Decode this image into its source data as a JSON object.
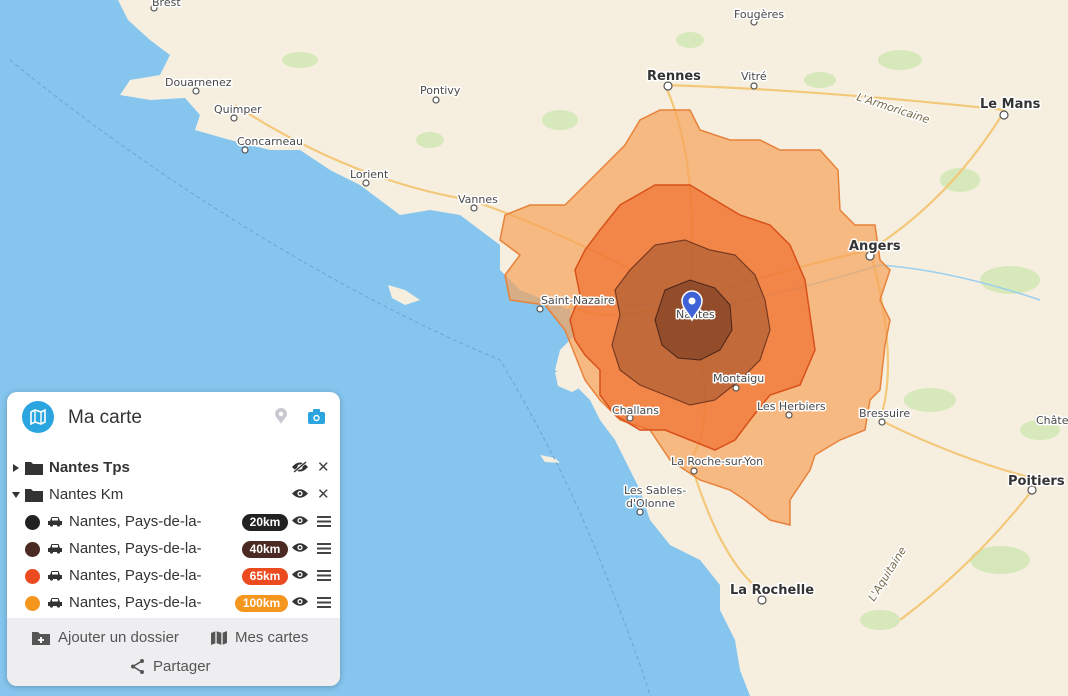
{
  "map": {
    "cities": [
      {
        "name": "Brest"
      },
      {
        "name": "Fougères"
      },
      {
        "name": "Rennes"
      },
      {
        "name": "Vitré"
      },
      {
        "name": "Douarnenez"
      },
      {
        "name": "Pontivy"
      },
      {
        "name": "Le Mans"
      },
      {
        "name": "L'Armoricaine"
      },
      {
        "name": "Quimper"
      },
      {
        "name": "Concarneau"
      },
      {
        "name": "Lorient"
      },
      {
        "name": "Vannes"
      },
      {
        "name": "Angers"
      },
      {
        "name": "Saint-Nazaire"
      },
      {
        "name": "Nantes"
      },
      {
        "name": "Montaigu"
      },
      {
        "name": "Challans"
      },
      {
        "name": "Les Herbiers"
      },
      {
        "name": "Bressuire"
      },
      {
        "name": "Châte"
      },
      {
        "name": "La Roche-sur-Yon"
      },
      {
        "name": "Poitiers"
      },
      {
        "name": "Les Sables-"
      },
      {
        "name": "d'Olonne"
      },
      {
        "name": "La Rochelle"
      },
      {
        "name": "L'Aquitaine"
      }
    ],
    "colors": {
      "sea": "#85c5ee",
      "land": "#f6efe0",
      "zone100": "#f6a35a",
      "zone65": "#ee6a2a",
      "zone40": "#8a4a2a",
      "zone20": "#2a2a2a",
      "marker": "#3f62d6"
    }
  },
  "panel": {
    "title": "Ma carte",
    "icons": {
      "logo": "map-app-icon",
      "pin": "map-pin-icon",
      "camera": "camera-icon"
    },
    "folders": [
      {
        "label": "Nantes Tps",
        "expanded": false,
        "visible": false
      },
      {
        "label": "Nantes Km",
        "expanded": true,
        "visible": true
      }
    ],
    "layers": [
      {
        "label": "Nantes, Pays-de-la-",
        "badge": "20km",
        "color": "#222222",
        "badge_color": "#222222"
      },
      {
        "label": "Nantes, Pays-de-la-",
        "badge": "40km",
        "color": "#4a2a22",
        "badge_color": "#4a2a22"
      },
      {
        "label": "Nantes, Pays-de-la-",
        "badge": "65km",
        "color": "#ec4a1f",
        "badge_color": "#ec4a1f"
      },
      {
        "label": "Nantes, Pays-de-la-",
        "badge": "100km",
        "color": "#f5961f",
        "badge_color": "#f5961f"
      }
    ],
    "footer": {
      "add_folder": "Ajouter un dossier",
      "my_maps": "Mes cartes",
      "share": "Partager"
    }
  }
}
